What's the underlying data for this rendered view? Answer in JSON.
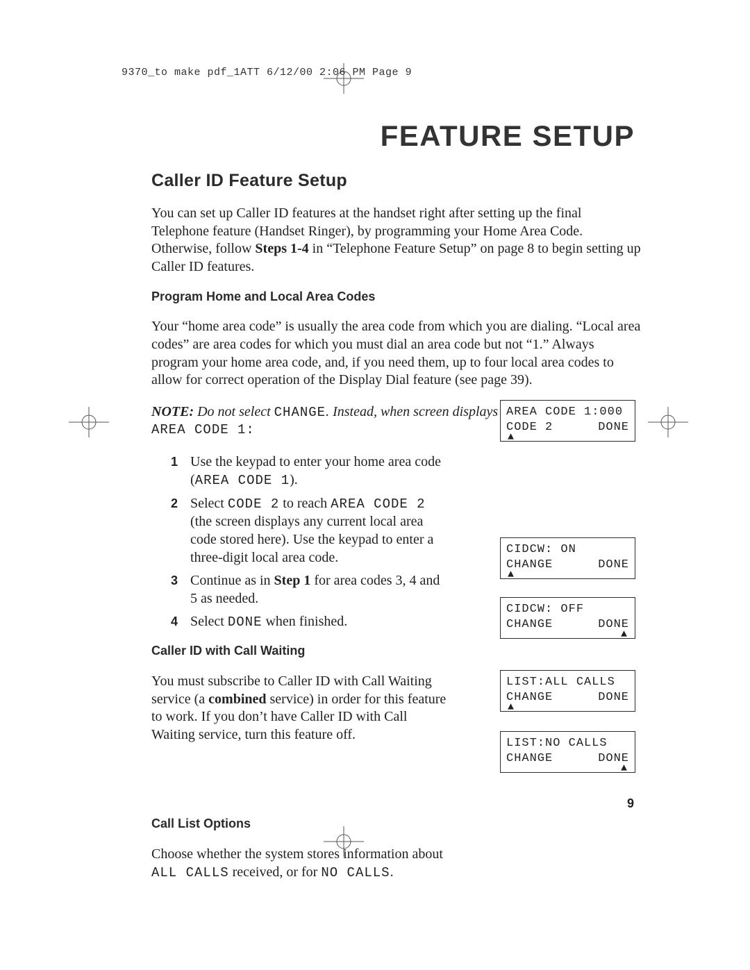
{
  "slug": "9370_to make pdf_1ATT  6/12/00  2:06 PM  Page 9",
  "running_title": "FEATURE SETUP",
  "h2": "Caller ID Feature Setup",
  "intro_1": "You can set up Caller ID features at the handset right after setting up the final Telephone feature (Handset Ringer), by programming your Home Area Code.  Otherwise, follow ",
  "intro_steps14": "Steps 1-4",
  "intro_2": " in “Telephone Feature Setup” on page 8 to begin setting up Caller ID features.",
  "h3a": "Program Home and Local Area Codes",
  "paraA": "Your “home area code” is usually the area code from which you are dialing. “Local area codes” are area codes for which you must dial an area code but not “1.” Always program your home area code, and, if you need them, up to four local area codes to allow for correct operation of the Display Dial feature (see page 39).",
  "note_lead": "NOTE:",
  "note_body1": " Do not select ",
  "note_mono1": "CHANGE",
  "note_body2": ".  Instead, when screen displays",
  "note_mono_line": "AREA CODE 1:",
  "steps": [
    {
      "n": "1",
      "pre": "Use the keypad to enter your home area code (",
      "m1": "AREA CODE 1",
      "post": ")."
    },
    {
      "n": "2",
      "pre": "Select ",
      "m1": "CODE 2",
      "mid": " to reach ",
      "m2": "AREA CODE 2",
      "post": " (the screen displays any current local area code stored here).  Use the keypad to enter a three-digit local area code."
    },
    {
      "n": "3",
      "pre1": "Continue as in ",
      "strong": "Step 1",
      "post": " for area codes 3, 4 and 5 as needed."
    },
    {
      "n": "4",
      "pre": "Select ",
      "m1": "DONE",
      "post": " when finished."
    }
  ],
  "h3b": "Caller ID with Call Waiting",
  "paraB_1": "You must subscribe to Caller ID with Call Waiting service (a ",
  "paraB_strong": "combined",
  "paraB_2": " service) in order for this feature to work.  If you don’t have Caller ID with Call Waiting service, turn this feature off.",
  "h3c": "Call List Options",
  "paraC_1": "Choose whether the system stores information about ",
  "paraC_m1": "ALL CALLS",
  "paraC_2": " received, or for ",
  "paraC_m2": "NO CALLS",
  "paraC_3": ".",
  "lcd1": {
    "l1": "AREA CODE 1:000",
    "l2a": "CODE 2",
    "l2b": "DONE"
  },
  "lcd2": {
    "l1": "CIDCW: ON",
    "l2a": "CHANGE",
    "l2b": "DONE"
  },
  "lcd3": {
    "l1": "CIDCW: OFF",
    "l2a": "CHANGE",
    "l2b": "DONE"
  },
  "lcd4": {
    "l1": "LIST:ALL CALLS",
    "l2a": "CHANGE",
    "l2b": "DONE"
  },
  "lcd5": {
    "l1": "LIST:NO CALLS",
    "l2a": "CHANGE",
    "l2b": "DONE"
  },
  "page_number": "9"
}
